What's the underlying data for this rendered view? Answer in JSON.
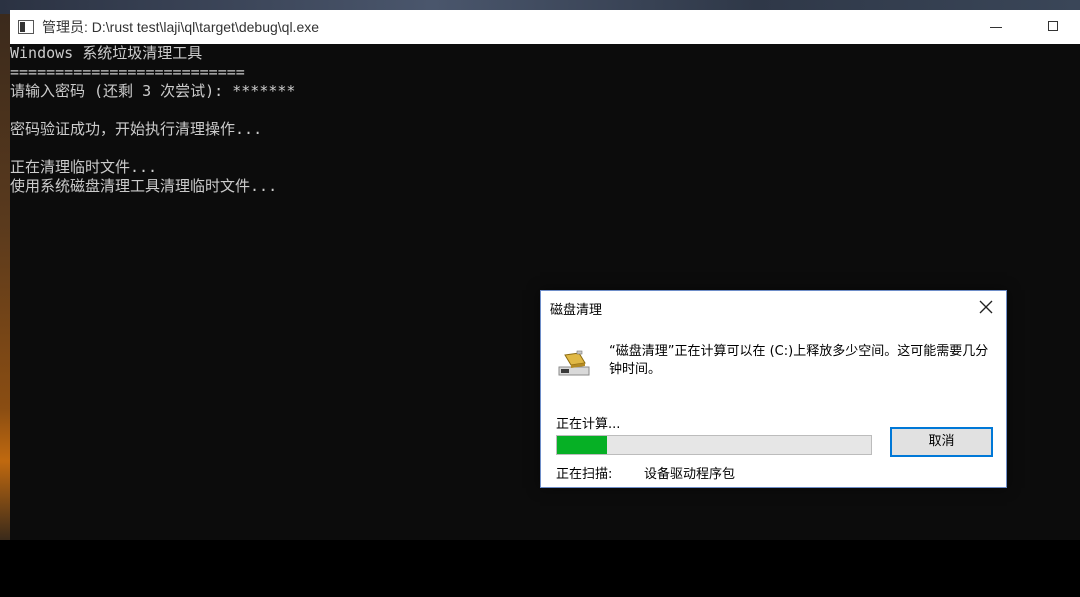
{
  "console": {
    "title": "管理员: D:\\rust test\\laji\\ql\\target\\debug\\ql.exe",
    "lines": [
      "Windows 系统垃圾清理工具",
      "==========================",
      "请输入密码 (还剩 3 次尝试): *******",
      "",
      "密码验证成功，开始执行清理操作...",
      "",
      "正在清理临时文件...",
      "使用系统磁盘清理工具清理临时文件..."
    ]
  },
  "dialog": {
    "title": "磁盘清理",
    "icon": "disk-cleanup-icon",
    "message": "“磁盘清理”正在计算可以在 (C:)上释放多少空间。这可能需要几分钟时间。",
    "status": "正在计算...",
    "progress_percent": 16,
    "cancel_label": "取消",
    "scanning_label": "正在扫描:",
    "scanning_item": "设备驱动程序包"
  },
  "colors": {
    "console_bg": "#0c0c0c",
    "console_text": "#cccccc",
    "progress_fill": "#06b025",
    "button_focus_border": "#0078d7"
  }
}
